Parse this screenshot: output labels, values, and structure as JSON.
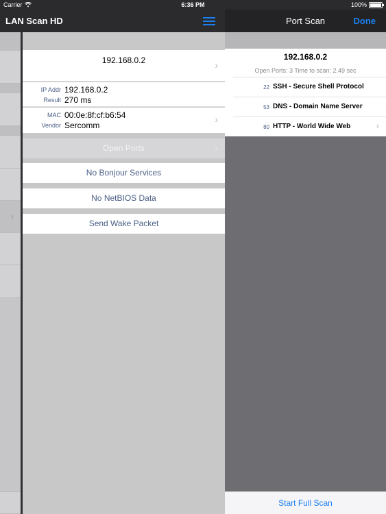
{
  "status_bar": {
    "carrier": "Carrier",
    "time": "6:36 PM",
    "battery": "100%"
  },
  "left_nav": {
    "title": "LAN Scan HD",
    "menu_icon": "list-menu-icon"
  },
  "host": {
    "ip_header": "192.168.0.2",
    "ip_label": "IP Addr",
    "ip_value": "192.168.0.2",
    "result_label": "Result",
    "result_value": "270 ms",
    "mac_label": "MAC",
    "mac_value": "00:0e:8f:cf:b6:54",
    "vendor_label": "Vendor",
    "vendor_value": "Sercomm"
  },
  "actions": {
    "open_ports": "Open Ports",
    "bonjour": "No Bonjour Services",
    "netbios": "No NetBIOS Data",
    "wake": "Send Wake Packet"
  },
  "port_scan": {
    "title": "Port Scan",
    "done": "Done",
    "ip": "192.168.0.2",
    "summary": "Open Ports: 3  Time to scan: 2.49 sec",
    "ports": [
      {
        "number": "22",
        "name": "SSH - Secure Shell Protocol"
      },
      {
        "number": "53",
        "name": "DNS - Domain Name Server"
      },
      {
        "number": "80",
        "name": "HTTP - World Wide Web"
      }
    ],
    "start_full_scan": "Start Full Scan"
  },
  "colors": {
    "accent": "#1a7ff0",
    "label": "#4a5e86"
  }
}
